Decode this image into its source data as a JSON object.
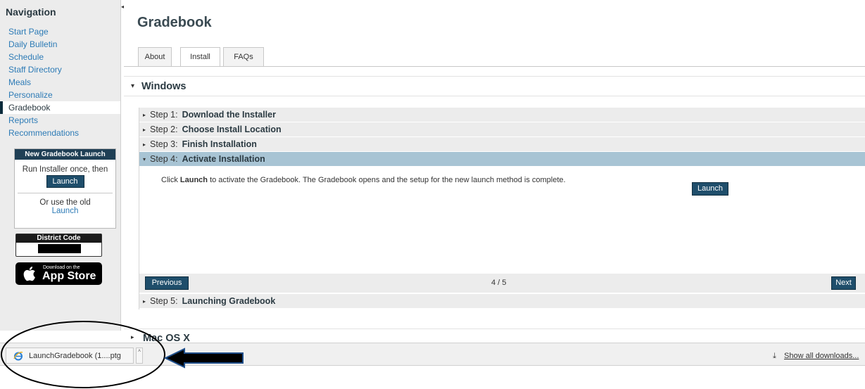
{
  "sidebar": {
    "title": "Navigation",
    "items": [
      {
        "label": "Start Page"
      },
      {
        "label": "Daily Bulletin"
      },
      {
        "label": "Schedule"
      },
      {
        "label": "Staff Directory"
      },
      {
        "label": "Meals"
      },
      {
        "label": "Personalize"
      },
      {
        "label": "Gradebook",
        "active": true
      },
      {
        "label": "Reports"
      },
      {
        "label": "Recommendations"
      }
    ],
    "launch_box": {
      "header": "New Gradebook Launch",
      "text1": "Run Installer once, then",
      "button": "Launch",
      "text2": "Or use the old",
      "old_link": "Launch"
    },
    "district": {
      "header": "District Code"
    },
    "app_store": {
      "small": "Download on the",
      "big": "App Store"
    }
  },
  "main": {
    "title": "Gradebook",
    "tabs": [
      {
        "label": "About"
      },
      {
        "label": "Install",
        "active": true
      },
      {
        "label": "FAQs"
      }
    ],
    "windows_section": {
      "title": "Windows"
    },
    "steps": [
      {
        "num": "Step 1:",
        "name": "Download the Installer"
      },
      {
        "num": "Step 2:",
        "name": "Choose Install Location"
      },
      {
        "num": "Step 3:",
        "name": "Finish Installation"
      },
      {
        "num": "Step 4:",
        "name": "Activate Installation",
        "open": true
      },
      {
        "num": "Step 5:",
        "name": "Launching Gradebook"
      }
    ],
    "step4": {
      "text_pre": "Click ",
      "text_bold": "Launch",
      "text_post": " to activate the Gradebook. The Gradebook opens and the setup for the new launch method is complete.",
      "button": "Launch"
    },
    "pager": {
      "prev": "Previous",
      "count": "4 / 5",
      "next": "Next"
    },
    "mac_section": {
      "title": "Mac OS X"
    }
  },
  "downloads_bar": {
    "file_name": "LaunchGradebook (1....ptg",
    "show_all": "Show all downloads..."
  },
  "colors": {
    "accent": "#1f4e6b",
    "link": "#2d7bb6",
    "step_open": "#a8c4d4",
    "annotation_arrow": "#1f4e8a"
  },
  "icons": {
    "download_item": "ie-icon",
    "show_all": "download-arrow-icon",
    "app_store": "apple-icon"
  }
}
